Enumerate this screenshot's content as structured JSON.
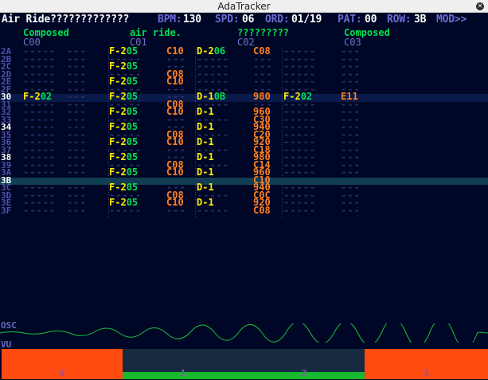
{
  "window": {
    "title": "AdaTracker",
    "close_glyph": "✕"
  },
  "status": {
    "song_title": "Air Ride?????????????",
    "bpm_label": "BPM:",
    "bpm": "130",
    "spd_label": "SPD:",
    "spd": "06",
    "ord_label": "ORD:",
    "ord": "01/19",
    "pat_label": "PAT:",
    "pat": "00",
    "row_label": "ROW:",
    "row": "3B",
    "mod_label": "MOD>>"
  },
  "channels": [
    {
      "name": "Composed",
      "code": "C00"
    },
    {
      "name": "air ride.",
      "code": "C01"
    },
    {
      "name": "?????????",
      "code": "C02"
    },
    {
      "name": "Composed",
      "code": "C03"
    }
  ],
  "rows": [
    {
      "n": "2A",
      "c": [
        {
          "d": "-"
        },
        {
          "note": "F-2",
          "oct": "05",
          "fx": "C10"
        },
        {
          "note": "D-2",
          "oct": "06",
          "fx": "C08"
        },
        {
          "d": "-"
        }
      ]
    },
    {
      "n": "2B",
      "c": [
        {
          "d": "-"
        },
        {
          "d": "-"
        },
        {
          "d": "-"
        },
        {
          "d": "-"
        }
      ]
    },
    {
      "n": "2C",
      "c": [
        {
          "d": "-"
        },
        {
          "note": "F-2",
          "oct": "05",
          "fx": ""
        },
        {
          "d": "-"
        },
        {
          "d": "-"
        }
      ]
    },
    {
      "n": "2D",
      "c": [
        {
          "d": "-"
        },
        {
          "d": "-",
          "fx": "C08"
        },
        {
          "d": "-"
        },
        {
          "d": "-"
        }
      ]
    },
    {
      "n": "2E",
      "c": [
        {
          "d": "-"
        },
        {
          "note": "F-2",
          "oct": "05",
          "fx": "C10"
        },
        {
          "d": "-"
        },
        {
          "d": "-"
        }
      ]
    },
    {
      "n": "2F",
      "c": [
        {
          "d": "-"
        },
        {
          "d": "-"
        },
        {
          "d": "-"
        },
        {
          "d": "-"
        }
      ]
    },
    {
      "n": "30",
      "c": [
        {
          "note": "F-2",
          "oct": "02",
          "fx": ""
        },
        {
          "note": "F-2",
          "oct": "05",
          "fx": ""
        },
        {
          "note": "D-1",
          "oct": "0B",
          "fx": "980"
        },
        {
          "note": "F-2",
          "oct": "02",
          "fx": "E11"
        }
      ]
    },
    {
      "n": "31",
      "c": [
        {
          "d": "-"
        },
        {
          "d": "-",
          "fx": "C08"
        },
        {
          "d": "-"
        },
        {
          "d": "-"
        }
      ]
    },
    {
      "n": "32",
      "c": [
        {
          "d": "-"
        },
        {
          "note": "F-2",
          "oct": "05",
          "fx": "C10"
        },
        {
          "note": "D-1",
          "oct": "",
          "fx": "960"
        },
        {
          "d": "-"
        }
      ]
    },
    {
      "n": "33",
      "c": [
        {
          "d": "-"
        },
        {
          "d": "-"
        },
        {
          "d": "-",
          "fx": "C30"
        },
        {
          "d": "-"
        }
      ]
    },
    {
      "n": "34",
      "c": [
        {
          "d": "-"
        },
        {
          "note": "F-2",
          "oct": "05",
          "fx": ""
        },
        {
          "note": "D-1",
          "oct": "",
          "fx": "940"
        },
        {
          "d": "-"
        }
      ]
    },
    {
      "n": "35",
      "c": [
        {
          "d": "-"
        },
        {
          "d": "-",
          "fx": "C08"
        },
        {
          "d": "-",
          "fx": "C20"
        },
        {
          "d": "-"
        }
      ]
    },
    {
      "n": "36",
      "c": [
        {
          "d": "-"
        },
        {
          "note": "F-2",
          "oct": "05",
          "fx": "C10"
        },
        {
          "note": "D-1",
          "oct": "",
          "fx": "920"
        },
        {
          "d": "-"
        }
      ]
    },
    {
      "n": "37",
      "c": [
        {
          "d": "-"
        },
        {
          "d": "-"
        },
        {
          "d": "-",
          "fx": "C18"
        },
        {
          "d": "-"
        }
      ]
    },
    {
      "n": "38",
      "c": [
        {
          "d": "-"
        },
        {
          "note": "F-2",
          "oct": "05",
          "fx": ""
        },
        {
          "note": "D-1",
          "oct": "",
          "fx": "980"
        },
        {
          "d": "-"
        }
      ]
    },
    {
      "n": "39",
      "c": [
        {
          "d": "-"
        },
        {
          "d": "-",
          "fx": "C08"
        },
        {
          "d": "-",
          "fx": "C14"
        },
        {
          "d": "-"
        }
      ]
    },
    {
      "n": "3A",
      "c": [
        {
          "d": "-"
        },
        {
          "note": "F-2",
          "oct": "05",
          "fx": "C10"
        },
        {
          "note": "D-1",
          "oct": "",
          "fx": "960"
        },
        {
          "d": "-"
        }
      ]
    },
    {
      "n": "3B",
      "c": [
        {
          "d": "-"
        },
        {
          "d": "-"
        },
        {
          "d": "-",
          "fx": "C10"
        },
        {
          "d": "-"
        }
      ]
    },
    {
      "n": "3C",
      "c": [
        {
          "d": "-"
        },
        {
          "note": "F-2",
          "oct": "05",
          "fx": ""
        },
        {
          "note": "D-1",
          "oct": "",
          "fx": "940"
        },
        {
          "d": "-"
        }
      ]
    },
    {
      "n": "3D",
      "c": [
        {
          "d": "-"
        },
        {
          "d": "-",
          "fx": "C08"
        },
        {
          "d": "-",
          "fx": "C0C"
        },
        {
          "d": "-"
        }
      ]
    },
    {
      "n": "3E",
      "c": [
        {
          "d": "-"
        },
        {
          "note": "F-2",
          "oct": "05",
          "fx": "C10"
        },
        {
          "note": "D-1",
          "oct": "",
          "fx": "920"
        },
        {
          "d": "-"
        }
      ]
    },
    {
      "n": "3F",
      "c": [
        {
          "d": "-"
        },
        {
          "d": "-"
        },
        {
          "d": "-",
          "fx": "C08"
        },
        {
          "d": "-"
        }
      ]
    }
  ],
  "cursor_row": "3B",
  "highlight_rows": [
    "30",
    "34",
    "38",
    "3B"
  ],
  "osc_label": "OSC",
  "vu_label": "VU",
  "vu": [
    {
      "ch": "0",
      "level": 1.0,
      "color": "#ff4a10"
    },
    {
      "ch": "1",
      "level": 0.25,
      "color": "#18b830"
    },
    {
      "ch": "2",
      "level": 0.25,
      "color": "#18b830"
    },
    {
      "ch": "3",
      "level": 1.0,
      "color": "#ff4a10"
    }
  ],
  "colors": {
    "bg": "#000726",
    "note": "#ffee00",
    "octave": "#00e050",
    "effect": "#ff8020",
    "channel_name": "#00e050"
  }
}
